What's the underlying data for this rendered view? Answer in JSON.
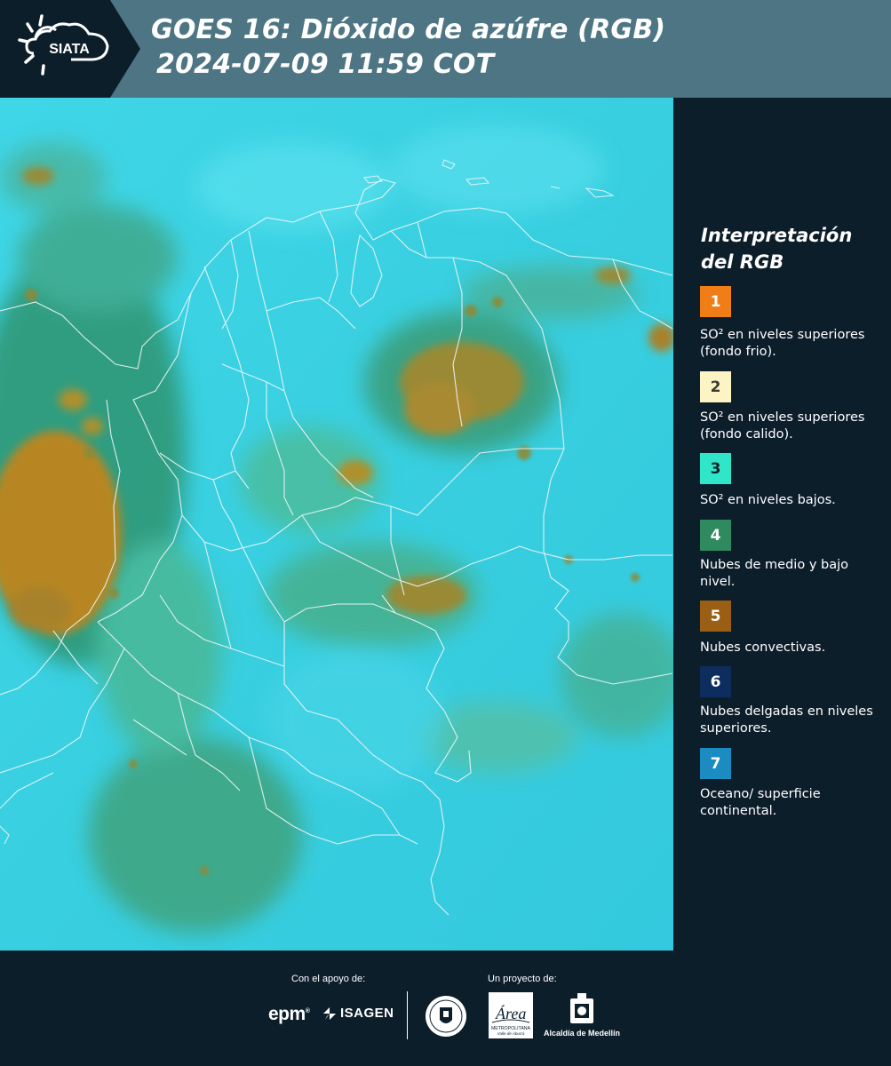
{
  "header": {
    "logo_text": "SIATA",
    "title_line1": "GOES 16: Dióxido de azúfre (RGB)",
    "title_line2": "2024-07-09 11:59 COT"
  },
  "legend": {
    "title_line1": "Interpretación",
    "title_line2": "del RGB",
    "items": [
      {
        "number": "1",
        "color": "#f07d16",
        "text_color": "#ffffff",
        "label": "SO² en niveles superiores (fondo frio)."
      },
      {
        "number": "2",
        "color": "#fdf4c4",
        "text_color": "#3b3b3b",
        "label": "SO² en niveles superiores (fondo calido)."
      },
      {
        "number": "3",
        "color": "#2fe6c9",
        "text_color": "#0d1e2b",
        "label": "SO² en niveles bajos."
      },
      {
        "number": "4",
        "color": "#2f8a60",
        "text_color": "#ffffff",
        "label": "Nubes de medio y bajo nivel."
      },
      {
        "number": "5",
        "color": "#9a5e14",
        "text_color": "#ffffff",
        "label": "Nubes convectivas."
      },
      {
        "number": "6",
        "color": "#0d2d5e",
        "text_color": "#ffffff",
        "label": "Nubes delgadas en niveles superiores."
      },
      {
        "number": "7",
        "color": "#1a8cc1",
        "text_color": "#ffffff",
        "label": "Oceano/ superficie continental."
      }
    ]
  },
  "footer": {
    "support_label": "Con el apoyo de:",
    "project_label": "Un proyecto de:",
    "sponsor_1": "epm",
    "sponsor_2": "ISAGEN",
    "partner_area_logo": "Área",
    "partner_area": "METROPOLITANA",
    "partner_area_sub": "Valle de Aburrá",
    "partner_alcaldia": "Alcaldía de Medellín"
  }
}
